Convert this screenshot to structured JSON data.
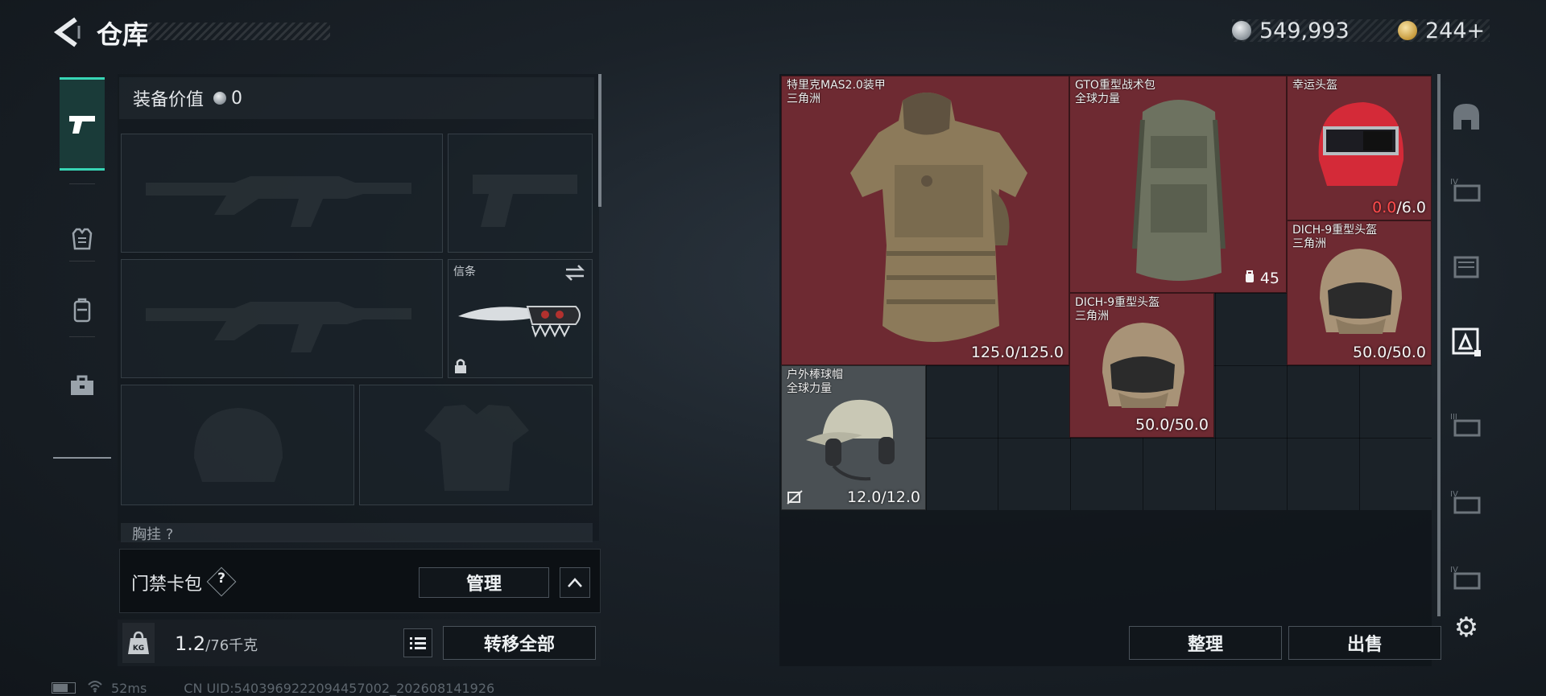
{
  "header": {
    "title": "仓库"
  },
  "currency": [
    {
      "icon": "silver-coin-icon",
      "value": "549,993"
    },
    {
      "icon": "gold-coin-icon",
      "value": "244+"
    }
  ],
  "tabs": [
    {
      "icon": "pistol-icon",
      "active": true
    },
    {
      "icon": "armor-vest-icon",
      "active": false
    },
    {
      "icon": "backpack-icon",
      "active": false
    },
    {
      "icon": "briefcase-icon",
      "active": false
    }
  ],
  "equipment": {
    "value_label": "装备价值",
    "value": "0",
    "melee_label": "信条",
    "chest_label": "胸挂 ?"
  },
  "card_pack": {
    "label": "门禁卡包",
    "help": "?",
    "manage_label": "管理",
    "expand_icon": "chevron-up-icon"
  },
  "weight": {
    "current": "1.2",
    "max": "/76千克",
    "transfer_label": "转移全部"
  },
  "status": {
    "ping": "52ms",
    "uid": "CN UID:5403969222094457002_202608141926"
  },
  "inventory": {
    "items": [
      {
        "name": "特里克MAS2.0装甲",
        "sub": "三角洲",
        "durability": "125.0/125.0"
      },
      {
        "name": "GTO重型战术包",
        "sub": "全球力量",
        "capacity": "45"
      },
      {
        "name": "幸运头盔",
        "sub": "",
        "dur_current": "0.0",
        "dur_max": "/6.0"
      },
      {
        "name": "DICH-9重型头盔",
        "sub": "三角洲",
        "durability": "50.0/50.0"
      },
      {
        "name": "DICH-9重型头盔",
        "sub": "三角洲",
        "durability": "50.0/50.0"
      },
      {
        "name": "户外棒球帽",
        "sub": "全球力量",
        "durability": "12.0/12.0"
      }
    ],
    "sort_label": "整理",
    "sell_label": "出售"
  },
  "sidebar_icons": [
    "helmet-category-icon",
    "level-4-armor-icon",
    "vest-icon",
    "armor-filter-icon",
    "level-3-vest-icon",
    "level-4-vest-icon",
    "level-4-armor-icon"
  ],
  "colors": {
    "accent": "#38d5b5",
    "item_bg": "#6e2a32",
    "warning": "#ff4b4b"
  }
}
